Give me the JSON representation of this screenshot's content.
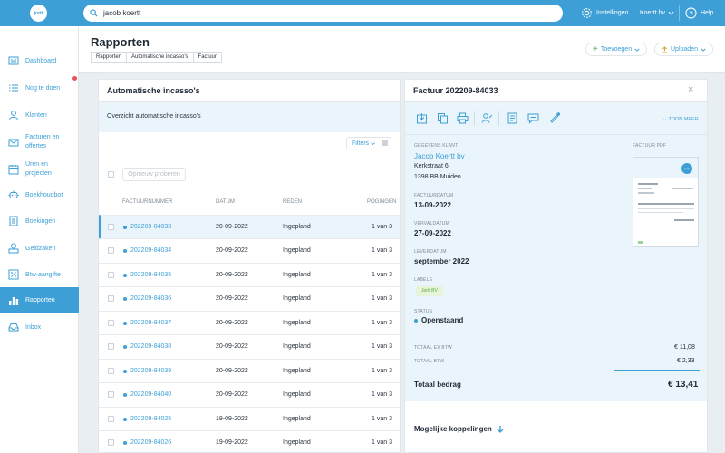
{
  "app": {
    "logo_text": "jortt",
    "accent": "#3d9fd6"
  },
  "search": {
    "value": "jacob koertt",
    "placeholder": "Zoeken"
  },
  "topbar": {
    "settings_label": "Instellingen",
    "account_label": "Koertt.bv",
    "help_label": "Help"
  },
  "sidebar": {
    "items": [
      {
        "label": "Dashboard",
        "icon": "dashboard-icon"
      },
      {
        "label": "Nog te doen",
        "icon": "todo-list-icon",
        "badge": true
      },
      {
        "label": "Klanten",
        "icon": "customer-icon"
      },
      {
        "label1": "Facturen en",
        "label2": "offertes",
        "icon": "invoice-icon"
      },
      {
        "label1": "Uren en",
        "label2": "projecten",
        "icon": "clock-icon"
      },
      {
        "label": "Boekhoudbot",
        "icon": "robot-icon"
      },
      {
        "label": "Boekingen",
        "icon": "bookings-icon"
      },
      {
        "label": "Geldzaken",
        "icon": "money-icon"
      },
      {
        "label": "Btw-aangifte",
        "icon": "percent-icon"
      },
      {
        "label": "Rapporten",
        "icon": "chart-icon",
        "active": true
      },
      {
        "label": "Inbox",
        "icon": "inbox-icon"
      }
    ]
  },
  "header": {
    "title": "Rapporten",
    "breadcrumbs": [
      "Rapporten",
      "Automatische incasso's",
      "Factuur"
    ],
    "add_label": "Toevoegen",
    "upload_label": "Uploaden"
  },
  "list_panel": {
    "title": "Automatische incasso's",
    "subtitle": "Overzicht automatische incasso's",
    "filter_label": "Filters",
    "retry_label": "Opnieuw proberen",
    "columns": [
      "FACTUURNUMMER",
      "DATUM",
      "REDEN",
      "POGINGEN"
    ],
    "rows": [
      {
        "number": "202209-84033",
        "date": "20-09-2022",
        "reason": "Ingepland",
        "attempts": "1 van 3",
        "selected": true
      },
      {
        "number": "202209-84034",
        "date": "20-09-2022",
        "reason": "Ingepland",
        "attempts": "1 van 3"
      },
      {
        "number": "202209-84035",
        "date": "20-09-2022",
        "reason": "Ingepland",
        "attempts": "1 van 3"
      },
      {
        "number": "202209-84036",
        "date": "20-09-2022",
        "reason": "Ingepland",
        "attempts": "1 van 3"
      },
      {
        "number": "202209-84037",
        "date": "20-09-2022",
        "reason": "Ingepland",
        "attempts": "1 van 3"
      },
      {
        "number": "202209-84038",
        "date": "20-09-2022",
        "reason": "Ingepland",
        "attempts": "1 van 3"
      },
      {
        "number": "202209-84039",
        "date": "20-09-2022",
        "reason": "Ingepland",
        "attempts": "1 van 3"
      },
      {
        "number": "202209-84040",
        "date": "20-09-2022",
        "reason": "Ingepland",
        "attempts": "1 van 3"
      },
      {
        "number": "202209-84025",
        "date": "19-09-2022",
        "reason": "Ingepland",
        "attempts": "1 van 3"
      },
      {
        "number": "202209-84026",
        "date": "19-09-2022",
        "reason": "Ingepland",
        "attempts": "1 van 3"
      }
    ]
  },
  "detail_panel": {
    "title": "Factuur 202209-84033",
    "close_glyph": "×",
    "show_more_label": "TOON MEER",
    "customer_label": "GEGEVENS KLANT",
    "customer_name": "Jacob Koertt bv",
    "address_line1": "Kerkstraat 6",
    "address_line2": "1398 BB Muiden",
    "pdf_label": "FACTUUR PDF",
    "pdf_logo_text": "jortt",
    "invoice_date_label": "FACTUURDATUM",
    "invoice_date": "13-09-2022",
    "due_date_label": "VERVALDATUM",
    "due_date": "27-09-2022",
    "delivery_label": "LEVERDATUM",
    "delivery_date": "september 2022",
    "labels_label": "LABELS",
    "label_tag": "Jortt BV",
    "status_label": "STATUS",
    "status_value": "Openstaand",
    "total_ex_label": "TOTAAL EX BTW",
    "total_ex_value": "€ 11,08",
    "total_vat_label": "TOTAAL BTW",
    "total_vat_value": "€ 2,33",
    "total_label": "Totaal bedrag",
    "total_value": "€ 13,41",
    "links_label": "Mogelijke koppelingen"
  }
}
